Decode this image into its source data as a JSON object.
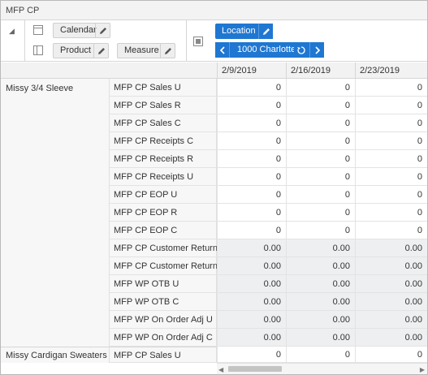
{
  "window": {
    "title": "MFP CP"
  },
  "pivot": {
    "calendar_label": "Calendar",
    "product_label": "Product",
    "measure_label": "Measure",
    "location_label": "Location",
    "location_value": "1000 Charlotte",
    "icons": [
      "collapse-triangle-icon",
      "row-axis-icon",
      "edit-pencil-icon",
      "column-axis-icon",
      "chevron-left-icon",
      "chevron-right-icon",
      "reset-icon"
    ]
  },
  "columns": [
    "2/9/2019",
    "2/16/2019",
    "2/23/2019"
  ],
  "groups": [
    {
      "name": "Missy 3/4 Sleeve",
      "rows": [
        {
          "label": "MFP CP Sales U",
          "values": [
            "0",
            "0",
            "0"
          ]
        },
        {
          "label": "MFP CP Sales R",
          "values": [
            "0",
            "0",
            "0"
          ]
        },
        {
          "label": "MFP CP Sales C",
          "values": [
            "0",
            "0",
            "0"
          ]
        },
        {
          "label": "MFP CP Receipts C",
          "values": [
            "0",
            "0",
            "0"
          ]
        },
        {
          "label": "MFP CP Receipts R",
          "values": [
            "0",
            "0",
            "0"
          ]
        },
        {
          "label": "MFP CP Receipts U",
          "values": [
            "0",
            "0",
            "0"
          ]
        },
        {
          "label": "MFP CP EOP U",
          "values": [
            "0",
            "0",
            "0"
          ]
        },
        {
          "label": "MFP CP EOP R",
          "values": [
            "0",
            "0",
            "0"
          ]
        },
        {
          "label": "MFP CP EOP C",
          "values": [
            "0",
            "0",
            "0"
          ]
        },
        {
          "label": "MFP CP Customer Returns U",
          "values": [
            "0.00",
            "0.00",
            "0.00"
          ]
        },
        {
          "label": "MFP CP Customer Returns R",
          "values": [
            "0.00",
            "0.00",
            "0.00"
          ]
        },
        {
          "label": "MFP WP OTB U",
          "values": [
            "0.00",
            "0.00",
            "0.00"
          ]
        },
        {
          "label": "MFP WP OTB C",
          "values": [
            "0.00",
            "0.00",
            "0.00"
          ]
        },
        {
          "label": "MFP WP On Order Adj U",
          "values": [
            "0.00",
            "0.00",
            "0.00"
          ]
        },
        {
          "label": "MFP WP On Order Adj C",
          "values": [
            "0.00",
            "0.00",
            "0.00"
          ]
        }
      ]
    },
    {
      "name": "Missy Cardigan Sweaters",
      "rows": [
        {
          "label": "MFP CP Sales U",
          "values": [
            "0",
            "0",
            "0"
          ]
        }
      ]
    }
  ],
  "colors": {
    "accent": "#1f77d2",
    "shaded_cell": "#eeeff1",
    "header_bg": "#f2f2f2"
  }
}
